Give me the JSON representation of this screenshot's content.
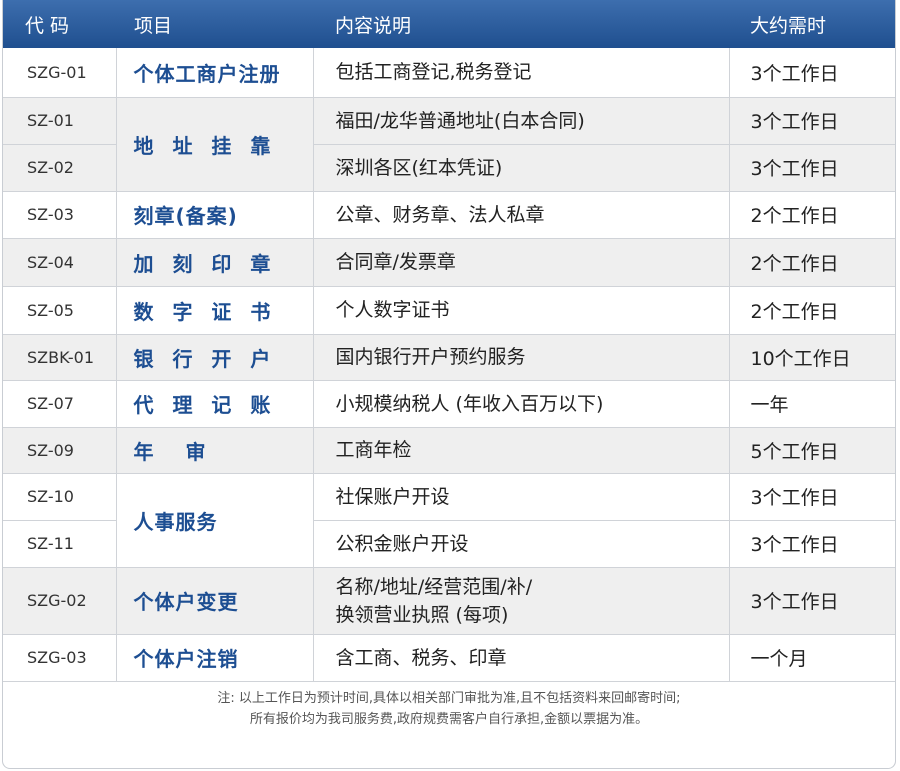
{
  "header": {
    "code": "代 码",
    "item": "项目",
    "desc": "内容说明",
    "time": "大约需时"
  },
  "rows": [
    {
      "code": "SZG-01",
      "item": "个体工商户注册",
      "desc": "包括工商登记,税务登记",
      "time": "3个工作日"
    },
    {
      "code": "SZ-01",
      "item": "地 址 挂 靠",
      "desc": "福田/龙华普通地址(白本合同)",
      "time": "3个工作日"
    },
    {
      "code": "SZ-02",
      "desc": "深圳各区(红本凭证)",
      "time": "3个工作日"
    },
    {
      "code": "SZ-03",
      "item": "刻章(备案)",
      "desc": "公章、财务章、法人私章",
      "time": "2个工作日"
    },
    {
      "code": "SZ-04",
      "item": "加 刻 印 章",
      "desc": "合同章/发票章",
      "time": "2个工作日"
    },
    {
      "code": "SZ-05",
      "item": "数 字 证 书",
      "desc": "个人数字证书",
      "time": "2个工作日"
    },
    {
      "code": "SZBK-01",
      "item": "银 行 开 户",
      "desc": "国内银行开户预约服务",
      "time": "10个工作日"
    },
    {
      "code": "SZ-07",
      "item": "代 理 记 账",
      "desc": "小规模纳税人 (年收入百万以下)",
      "time": "一年"
    },
    {
      "code": "SZ-09",
      "item": "年　审",
      "desc": "工商年检",
      "time": "5个工作日"
    },
    {
      "code": "SZ-10",
      "item": "人事服务",
      "desc": "社保账户开设",
      "time": "3个工作日"
    },
    {
      "code": "SZ-11",
      "desc": "公积金账户开设",
      "time": "3个工作日"
    },
    {
      "code": "SZG-02",
      "item": "个体户变更",
      "desc1": "名称/地址/经营范围/补/",
      "desc2": "换领营业执照 (每项)",
      "time": "3个工作日"
    },
    {
      "code": "SZG-03",
      "item": "个体户注销",
      "desc": "含工商、税务、印章",
      "time": "一个月"
    }
  ],
  "note": {
    "line1": "注: 以上工作日为预计时间,具体以相关部门审批为准,且不包括资料来回邮寄时间;",
    "line2": "所有报价均为我司服务费,政府规费需客户自行承担,金额以票据为准。"
  }
}
